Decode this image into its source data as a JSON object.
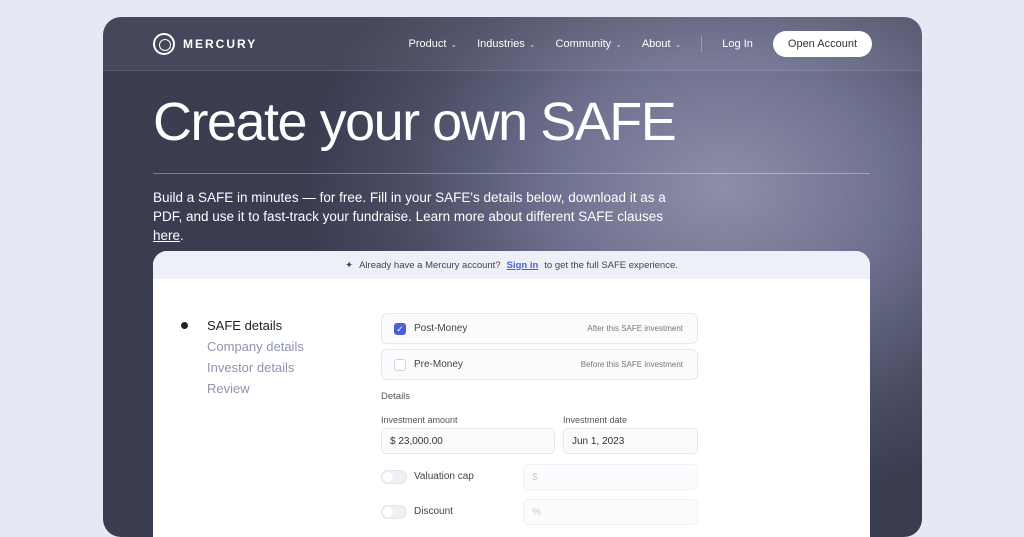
{
  "nav": {
    "brand": "MERCURY",
    "items": [
      "Product",
      "Industries",
      "Community",
      "About"
    ],
    "login": "Log In",
    "cta": "Open Account"
  },
  "hero": {
    "title": "Create your own SAFE",
    "intro_pre": "Build a SAFE in minutes — for free. Fill in your SAFE's details below, download it as a PDF, and use it to fast-track your fundraise. Learn more about different SAFE clauses ",
    "intro_link": "here",
    "intro_post": "."
  },
  "banner": {
    "pre": "Already have a Mercury account?",
    "link": "Sign in",
    "post": "to get the full SAFE experience."
  },
  "steps": [
    "SAFE details",
    "Company details",
    "Investor details",
    "Review"
  ],
  "options": [
    {
      "label": "Post-Money",
      "hint": "After this SAFE investment",
      "checked": true
    },
    {
      "label": "Pre-Money",
      "hint": "Before this SAFE investment",
      "checked": false
    }
  ],
  "details": {
    "heading": "Details",
    "amount_label": "Investment amount",
    "amount_value": "$  23,000.00",
    "date_label": "Investment date",
    "date_value": "Jun 1, 2023",
    "valuation_label": "Valuation cap",
    "valuation_placeholder": "$",
    "discount_label": "Discount",
    "discount_placeholder": "%"
  }
}
